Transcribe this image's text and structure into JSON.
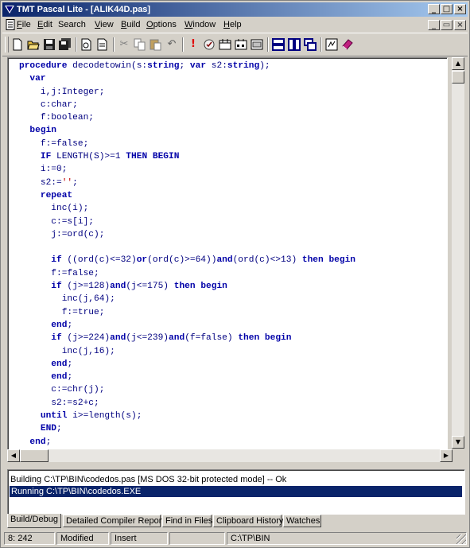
{
  "window": {
    "title": "TMT Pascal Lite - [ALIK44D.pas]",
    "controls": {
      "minimize": "_",
      "maximize": "□",
      "close": "×"
    },
    "mdi_controls": {
      "minimize": "_",
      "restore": "▭",
      "close": "×"
    }
  },
  "menu": [
    {
      "label": "File",
      "underline": "F",
      "rest": "ile"
    },
    {
      "label": "Edit",
      "underline": "E",
      "rest": "dit"
    },
    {
      "label": "Search",
      "underline": "",
      "rest": "Search"
    },
    {
      "label": "View",
      "underline": "V",
      "rest": "iew"
    },
    {
      "label": "Build",
      "underline": "B",
      "rest": "uild"
    },
    {
      "label": "Options",
      "underline": "O",
      "rest": "ptions"
    },
    {
      "label": "Window",
      "underline": "W",
      "rest": "indow"
    },
    {
      "label": "Help",
      "underline": "H",
      "rest": "elp"
    }
  ],
  "toolbar": [
    "new-file-icon",
    "open-folder-icon",
    "save-icon",
    "save-all-icon",
    "print-preview-icon",
    "print-icon",
    "cut-icon",
    "copy-icon",
    "paste-icon",
    "undo-icon",
    "run-icon",
    "compile-icon",
    "make-icon",
    "build-icon",
    "debug-icon",
    "tile-horizontal-icon",
    "tile-vertical-icon",
    "cascade-icon",
    "help-icon",
    "book-icon"
  ],
  "editor": {
    "code_lines": [
      [
        {
          "t": "procedure",
          "c": "kw"
        },
        {
          "t": " decodetowin(s:",
          "c": "tx"
        },
        {
          "t": "string",
          "c": "kw"
        },
        {
          "t": "; ",
          "c": "tx"
        },
        {
          "t": "var",
          "c": "kw"
        },
        {
          "t": " s2:",
          "c": "tx"
        },
        {
          "t": "string",
          "c": "kw"
        },
        {
          "t": ");",
          "c": "tx"
        }
      ],
      [
        {
          "t": "  var",
          "c": "kw"
        }
      ],
      [
        {
          "t": "    i,j:Integer;",
          "c": "tx"
        }
      ],
      [
        {
          "t": "    c:char;",
          "c": "tx"
        }
      ],
      [
        {
          "t": "    f:boolean;",
          "c": "tx"
        }
      ],
      [
        {
          "t": "  begin",
          "c": "kw"
        }
      ],
      [
        {
          "t": "    f:=false;",
          "c": "tx"
        }
      ],
      [
        {
          "t": "    IF",
          "c": "kw"
        },
        {
          "t": " LENGTH(S)>=1 ",
          "c": "tx"
        },
        {
          "t": "THEN BEGIN",
          "c": "kw"
        }
      ],
      [
        {
          "t": "    i:=0;",
          "c": "tx"
        }
      ],
      [
        {
          "t": "    s2:=",
          "c": "tx"
        },
        {
          "t": "''",
          "c": "str"
        },
        {
          "t": ";",
          "c": "tx"
        }
      ],
      [
        {
          "t": "    repeat",
          "c": "kw"
        }
      ],
      [
        {
          "t": "      inc(i);",
          "c": "tx"
        }
      ],
      [
        {
          "t": "      c:=s[i];",
          "c": "tx"
        }
      ],
      [
        {
          "t": "      j:=ord(c);",
          "c": "tx"
        }
      ],
      [
        {
          "t": "",
          "c": "tx"
        }
      ],
      [
        {
          "t": "      if",
          "c": "kw"
        },
        {
          "t": " ((ord(c)<=32)",
          "c": "tx"
        },
        {
          "t": "or",
          "c": "kw"
        },
        {
          "t": "(ord(c)>=64))",
          "c": "tx"
        },
        {
          "t": "and",
          "c": "kw"
        },
        {
          "t": "(ord(c)<>13) ",
          "c": "tx"
        },
        {
          "t": "then begin",
          "c": "kw"
        }
      ],
      [
        {
          "t": "      f:=false;",
          "c": "tx"
        }
      ],
      [
        {
          "t": "      if",
          "c": "kw"
        },
        {
          "t": " (j>=128)",
          "c": "tx"
        },
        {
          "t": "and",
          "c": "kw"
        },
        {
          "t": "(j<=175) ",
          "c": "tx"
        },
        {
          "t": "then begin",
          "c": "kw"
        }
      ],
      [
        {
          "t": "        inc(j,64);",
          "c": "tx"
        }
      ],
      [
        {
          "t": "        f:=true;",
          "c": "tx"
        }
      ],
      [
        {
          "t": "      end",
          "c": "kw"
        },
        {
          "t": ";",
          "c": "tx"
        }
      ],
      [
        {
          "t": "      if",
          "c": "kw"
        },
        {
          "t": " (j>=224)",
          "c": "tx"
        },
        {
          "t": "and",
          "c": "kw"
        },
        {
          "t": "(j<=239)",
          "c": "tx"
        },
        {
          "t": "and",
          "c": "kw"
        },
        {
          "t": "(f=false) ",
          "c": "tx"
        },
        {
          "t": "then begin",
          "c": "kw"
        }
      ],
      [
        {
          "t": "        inc(j,16);",
          "c": "tx"
        }
      ],
      [
        {
          "t": "      end",
          "c": "kw"
        },
        {
          "t": ";",
          "c": "tx"
        }
      ],
      [
        {
          "t": "      end",
          "c": "kw"
        },
        {
          "t": ";",
          "c": "tx"
        }
      ],
      [
        {
          "t": "      c:=chr(j);",
          "c": "tx"
        }
      ],
      [
        {
          "t": "      s2:=s2+c;",
          "c": "tx"
        }
      ],
      [
        {
          "t": "    until",
          "c": "kw"
        },
        {
          "t": " i>=length(s);",
          "c": "tx"
        }
      ],
      [
        {
          "t": "    END",
          "c": "kw"
        },
        {
          "t": ";",
          "c": "tx"
        }
      ],
      [
        {
          "t": "  end",
          "c": "kw"
        },
        {
          "t": ";",
          "c": "tx"
        }
      ]
    ]
  },
  "output": {
    "lines": [
      "Building C:\\TP\\BIN\\codedos.pas  [MS DOS 32-bit protected mode] -- Ok",
      "Running C:\\TP\\BIN\\codedos.EXE"
    ],
    "selected_index": 1
  },
  "tabs": [
    "Build/Debug",
    "Detailed Compiler Report",
    "Find in Files",
    "Clipboard History",
    "Watches"
  ],
  "active_tab": 0,
  "status": {
    "position": "8: 242",
    "modified": "Modified",
    "mode": "Insert",
    "blank": "",
    "path": "C:\\TP\\BIN"
  },
  "colors": {
    "keyword": "#0000a8",
    "text": "#000080",
    "string": "#c00000",
    "title_start": "#0a246a",
    "selection": "#0a246a"
  }
}
